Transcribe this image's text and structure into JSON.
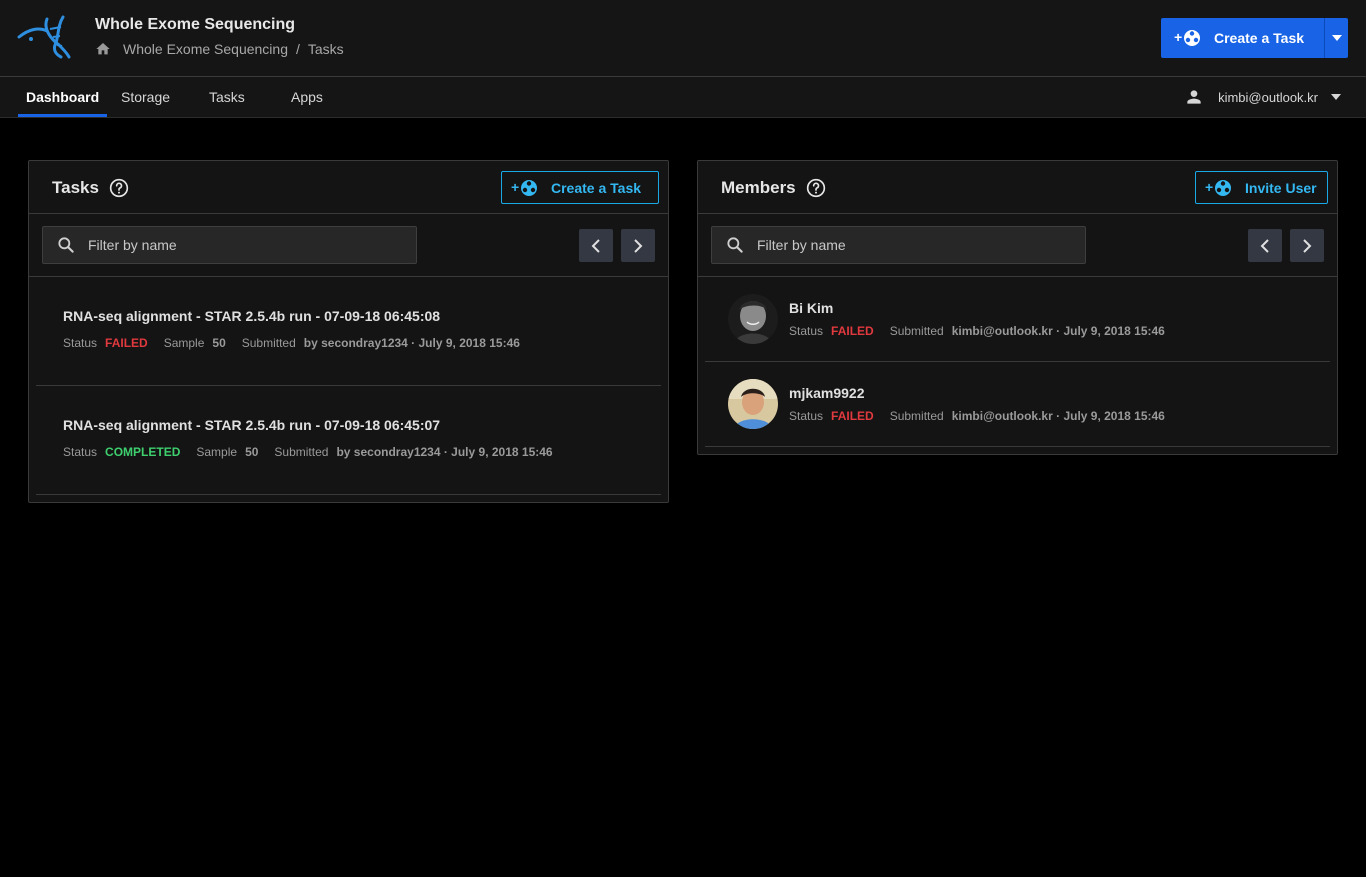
{
  "header": {
    "title": "Whole Exome Sequencing",
    "breadcrumb": [
      "Whole Exome Sequencing",
      "/",
      "Tasks"
    ],
    "primary_action": "Create a Task"
  },
  "tabs": [
    {
      "label": "Dashboard",
      "active": true
    },
    {
      "label": "Storage",
      "active": false
    },
    {
      "label": "Tasks",
      "active": false
    },
    {
      "label": "Apps",
      "active": false
    }
  ],
  "user": {
    "email": "kimbi@outlook.kr"
  },
  "tasks_panel": {
    "title": "Tasks",
    "action": "Create a Task",
    "filter_placeholder": "Filter by name",
    "items": [
      {
        "name": "RNA-seq alignment - STAR 2.5.4b run - 07-09-18 06:45:08",
        "status_label": "Status",
        "status": "FAILED",
        "sample_label": "Sample",
        "sample": "50",
        "submitted_label": "Submitted",
        "submitted": "by secondray1234 · July 9, 2018 15:46"
      },
      {
        "name": "RNA-seq alignment - STAR 2.5.4b run - 07-09-18 06:45:07",
        "status_label": "Status",
        "status": "COMPLETED",
        "sample_label": "Sample",
        "sample": "50",
        "submitted_label": "Submitted",
        "submitted": "by secondray1234 · July 9, 2018 15:46"
      }
    ]
  },
  "members_panel": {
    "title": "Members",
    "action": "Invite User",
    "filter_placeholder": "Filter by name",
    "items": [
      {
        "name": "Bi Kim",
        "status_label": "Status",
        "status": "FAILED",
        "submitted_label": "Submitted",
        "submitted": "kimbi@outlook.kr · July 9, 2018 15:46"
      },
      {
        "name": "mjkam9922",
        "status_label": "Status",
        "status": "FAILED",
        "submitted_label": "Submitted",
        "submitted": "kimbi@outlook.kr · July 9, 2018 15:46"
      }
    ]
  },
  "colors": {
    "accent": "#1863e6",
    "outline_accent": "#1aa8e6",
    "failed": "#e0393e",
    "completed": "#3ecf6e"
  },
  "icons": [
    "dna-logo-icon",
    "home-icon",
    "add-task-icon",
    "caret-down-icon",
    "user-icon",
    "help-icon",
    "search-icon",
    "chevron-left-icon",
    "chevron-right-icon",
    "invite-user-icon"
  ]
}
